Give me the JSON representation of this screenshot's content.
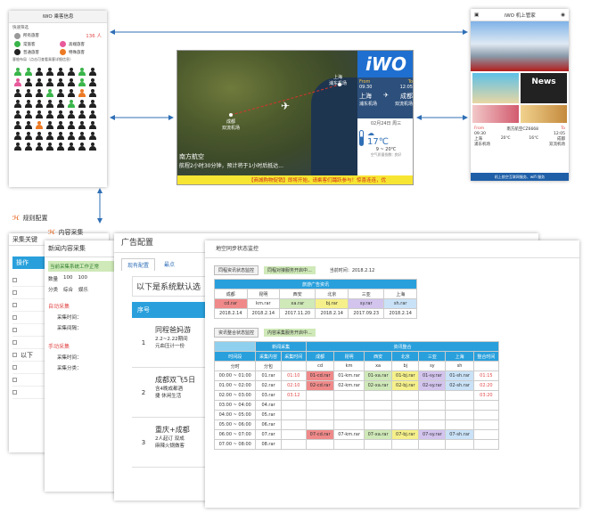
{
  "passenger": {
    "title": "iWO 乘客信息",
    "quick_filter": "快速筛选",
    "categories": [
      {
        "label": "所有旅客",
        "count": "136 人"
      },
      {
        "label": "常旅客"
      },
      {
        "label": "高端旅客"
      },
      {
        "label": "普通旅客"
      },
      {
        "label": "特殊旅客"
      }
    ],
    "layout_title": "客舱布局（点击可查看乘客详细信息）",
    "seat_number": "24"
  },
  "map": {
    "brand": "iWO",
    "city_from": "成都",
    "city_from_sub": "双流机场",
    "city_to": "上海",
    "city_to_sub": "浦东机场",
    "from_label": "From",
    "to_label": "To",
    "dep_time": "09:30",
    "arr_time": "12:05",
    "dest_city": "上海",
    "dest_airport": "浦东机场",
    "origin_city": "成都",
    "origin_airport": "双流机场",
    "date": "02月24日 周三",
    "temp": "17℃",
    "temp_range": "9 ~ 20℃",
    "wx_note": "空气质量指数: 良好",
    "airline": "南方航空",
    "flight_note": "航程2小时30分钟，预计将于1小时后抵达...",
    "ticker": "【商城购物促销】即将开始，请乘客们踊跃参与！惊喜连连，优"
  },
  "mobile": {
    "title": "iWO 机上管家",
    "news_label": "News",
    "flight_label": "南方航空CZ6668",
    "from_label": "From",
    "to_label": "To",
    "dep_time": "09:30",
    "arr_time": "12:05",
    "from_city": "上海",
    "from_airport": "浦东机场",
    "to_city": "成都",
    "to_airport": "双流机场",
    "temp_from": "20℃",
    "temp_to": "16℃",
    "footer": "机上航空互联网服务、wifi 服务"
  },
  "rule_panel": {
    "title": "规则配置",
    "tab": "采集关键",
    "col_op": "操作",
    "row_text": "以下"
  },
  "collect_panel": {
    "title": "内容采集",
    "subtitle": "新闻内容采集",
    "status": "当前采集系统工作正常",
    "count_label": "数量",
    "counts": [
      "100",
      "100"
    ],
    "cat_label": "分类",
    "cats": [
      "综合",
      "娱乐"
    ],
    "auto_title": "自动采集",
    "time_label": "采集时间：",
    "interval_label": "采集间隔：",
    "manual_title": "手动采集",
    "manual_time_label": "采集时间：",
    "manual_cat_label": "采集分类："
  },
  "ad_panel": {
    "title": "广告配置",
    "tabs": [
      "现有配置",
      "最点"
    ],
    "default_text": "以下是系统默认选",
    "col_no": "序号",
    "rows": [
      {
        "no": "1",
        "lines": [
          "同程爸妈游",
          "2.2~2.22期间",
          "元血压计一份"
        ]
      },
      {
        "no": "2",
        "lines": [
          "成都双飞5日",
          "含4晚成都酒",
          "捷 休闲生活"
        ]
      },
      {
        "no": "3",
        "lines": [
          "重庆+成都",
          "2人起订 双成",
          "麻辣火锅做客"
        ]
      }
    ]
  },
  "sync_panel": {
    "title": "地空同步状态监控",
    "section1": "同程资讯状态监控",
    "section1_badge": "同程对接服务开启中...",
    "current_time_label": "当前时间：",
    "current_time": "2018.2.12",
    "table1_title": "旅游广告资讯",
    "cities": [
      "成都",
      "昆明",
      "西安",
      "北京",
      "三亚",
      "上海"
    ],
    "files": [
      "cd.rar",
      "km.rar",
      "xa.rar",
      "bj.rar",
      "sy.rar",
      "sh.rar"
    ],
    "dates": [
      "2018.2.14",
      "2018.2.14",
      "2017.11.20",
      "2018.2.14",
      "2017.09.23",
      "2018.2.14"
    ],
    "section2": "资讯整合状态监控",
    "section2_badge": "内容采集服务开启中...",
    "news_header": "新闻采集",
    "merge_header": "资讯整合",
    "col_time": "时间段",
    "col_content": "采集内容",
    "col_collect_time": "采集时间",
    "col_merge_time": "整合时间",
    "unit_row": [
      "分时",
      "分包",
      "",
      "cd",
      "km",
      "xa",
      "bj",
      "sy",
      "sh"
    ],
    "rows": [
      [
        "00:00 ~ 01:00",
        "01.rar",
        "01:10",
        "01-cd.rar",
        "01-km.rar",
        "01-xa.rar",
        "01-bj.rar",
        "01-sy.rar",
        "01-sh.rar",
        "01:15"
      ],
      [
        "01:00 ~ 02:00",
        "02.rar",
        "02:10",
        "02-cd.rar",
        "02-km.rar",
        "02-xa.rar",
        "02-bj.rar",
        "02-sy.rar",
        "02-sh.rar",
        "02:20"
      ],
      [
        "02:00 ~ 03:00",
        "03.rar",
        "03:12",
        "",
        "",
        "",
        "",
        "",
        "",
        "03:20"
      ],
      [
        "03:00 ~ 04:00",
        "04.rar",
        "",
        "",
        "",
        "",
        "",
        "",
        "",
        ""
      ],
      [
        "04:00 ~ 05:00",
        "05.rar",
        "",
        "",
        "",
        "",
        "",
        "",
        "",
        ""
      ],
      [
        "05:00 ~ 06:00",
        "06.rar",
        "",
        "",
        "",
        "",
        "",
        "",
        "",
        ""
      ],
      [
        "06:00 ~ 07:00",
        "07.rar",
        "",
        "07-cd.rar",
        "07-km.rar",
        "07-xa.rar",
        "07-bj.rar",
        "07-sy.rar",
        "07-sh.rar",
        ""
      ],
      [
        "07:00 ~ 08:00",
        "08.rar",
        "",
        "",
        "",
        "",
        "",
        "",
        "",
        ""
      ]
    ]
  },
  "colors": {
    "blue": "#29a0dc",
    "red": "#e24a4a",
    "orange": "#ec7a24",
    "green": "#3ab54a",
    "file_colors": [
      "#f08a8a",
      "#ffffff",
      "#cfe9b8",
      "#f5f08a",
      "#d3c4ee",
      "#c9e2f7"
    ]
  }
}
